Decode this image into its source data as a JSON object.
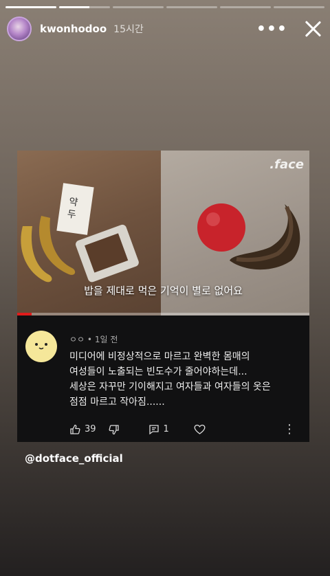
{
  "story": {
    "username": "kwonhodoo",
    "time": "15시간",
    "segments": [
      1.0,
      0.6,
      0.0,
      0.0,
      0.0,
      0.0
    ]
  },
  "video": {
    "caption": "밥을 제대로 먹은 기억이 별로 없어요",
    "logo": ".face",
    "progress": 0.05
  },
  "comment": {
    "author": "ㅇㅇ",
    "time": "1일 전",
    "lines": [
      "미디어에 비정상적으로 마르고 완벽한 몸매의",
      "여성들이 노출되는 빈도수가 줄어야하는데...",
      "세상은 자꾸만 기이해지고 여자들과 여자들의 옷은",
      "점점 마르고 작아짐......"
    ],
    "likes": "39",
    "replies": "1"
  },
  "credit": "@dotface_official"
}
